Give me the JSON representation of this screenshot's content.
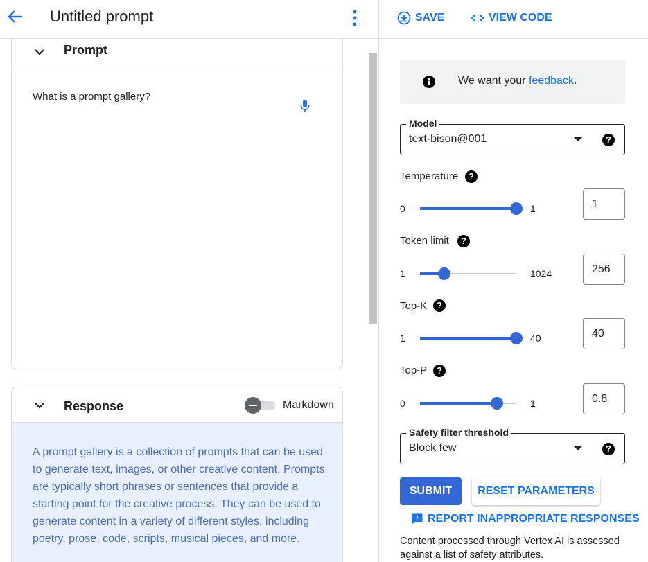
{
  "header": {
    "title": "Untitled prompt"
  },
  "prompt": {
    "section_title": "Prompt",
    "text": "What is a prompt gallery?"
  },
  "response": {
    "section_title": "Response",
    "markdown_label": "Markdown",
    "markdown_enabled": false,
    "text": "A prompt gallery is a collection of prompts that can be used to generate text, images, or other creative content. Prompts are typically short phrases or sentences that provide a starting point for the creative process. They can be used to generate content in a variety of different styles, including poetry, prose, code, scripts, musical pieces, and more."
  },
  "toolbar": {
    "save_label": "SAVE",
    "view_code_label": "VIEW CODE"
  },
  "feedback": {
    "prefix": "We want your ",
    "link": "feedback",
    "suffix": "."
  },
  "model": {
    "label": "Model",
    "value": "text-bison@001"
  },
  "params": {
    "temperature": {
      "label": "Temperature",
      "min": "0",
      "max": "1",
      "value": "1",
      "fraction": 1.0
    },
    "token_limit": {
      "label": "Token limit",
      "min": "1",
      "max": "1024",
      "value": "256",
      "fraction": 0.25
    },
    "top_k": {
      "label": "Top-K",
      "min": "1",
      "max": "40",
      "value": "40",
      "fraction": 1.0
    },
    "top_p": {
      "label": "Top-P",
      "min": "0",
      "max": "1",
      "value": "0.8",
      "fraction": 0.8
    }
  },
  "safety": {
    "label": "Safety filter threshold",
    "value": "Block few"
  },
  "actions": {
    "submit_label": "SUBMIT",
    "reset_label": "RESET PARAMETERS",
    "report_label": "REPORT INAPPROPRIATE RESPONSES"
  },
  "safety_note": "Content processed through Vertex AI is assessed against a list of safety attributes.",
  "colors": {
    "accent": "#1a73e8",
    "slider": "#3367d6",
    "response_bg": "#e8f0fe"
  }
}
